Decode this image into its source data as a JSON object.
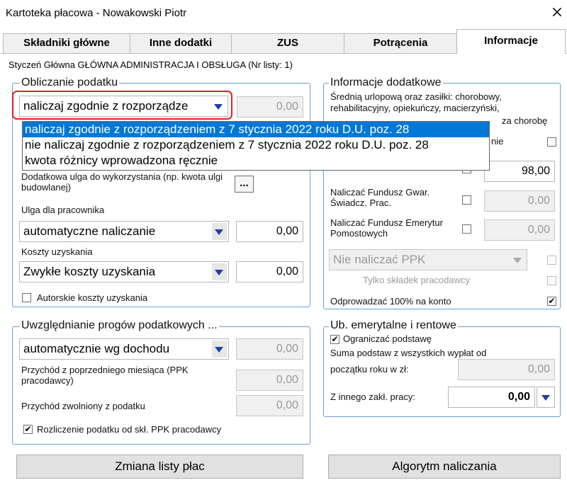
{
  "window": {
    "title": "Kartoteka płacowa - Nowakowski Piotr",
    "close_label": "×"
  },
  "tabs": [
    "Składniki główne",
    "Inne dodatki",
    "ZUS",
    "Potrącenia",
    "Informacje"
  ],
  "subtitle": "Styczeń Główna GŁÓWNA ADMINISTRACJA I OBSŁUGA  (Nr listy: 1)",
  "obliczanie": {
    "title": "Obliczanie podatku",
    "combo_value": "naliczaj zgodnie z rozporządze",
    "combo_amount": "0,00",
    "dropdown_options": [
      "naliczaj zgodnie z rozporządzeniem z 7 stycznia 2022 roku D.U. poz. 28",
      "nie naliczaj zgodnie z rozporządzeniem z 7 stycznia 2022 roku D.U. poz. 28",
      "kwota różnicy wprowadzona ręcznie"
    ],
    "dodatkowa_label": "Dodatkowa ulga do wykorzystania (np. kwota ulgi budowlanej)",
    "ellipsis": "...",
    "ulga_label": "Ulga dla pracownika",
    "ulga_value": "automatyczne naliczanie",
    "ulga_amount": "0,00",
    "koszty_label": "Koszty uzyskania",
    "koszty_value": "Zwykłe koszty uzyskania",
    "koszty_amount": "0,00",
    "autorskie_label": "Autorskie koszty uzyskania"
  },
  "progi": {
    "title": "Uwzględnianie progów podatkowych ...",
    "combo_value": "automatycznie wg dochodu",
    "combo_amount": "0,00",
    "przychod_label": "Przychód z poprzedniego miesiąca (PPK pracodawcy)",
    "przychod_amount": "0,00",
    "zwolniony_label": "Przychód zwolniony z podatku",
    "zwolniony_amount": "0,00",
    "rozliczenie_label": "Rozliczenie podatku od skł. PPK pracodawcy",
    "rozliczenie_checked": "✔"
  },
  "informacje": {
    "title": "Informacje dodatkowe",
    "srednia_label": "Średnią urlopową oraz zasiłki: chorobowy, rehabilitacyjny, opiekuńczy, macierzyński,",
    "za_chorobe": "za chorobę",
    "nie_fragment": "nie",
    "wartosc": "98,00",
    "fgsp_label": "Naliczać Fundusz Gwar. Świadcz. Prac.",
    "fgsp_amount": "0,00",
    "fep_label": "Naliczać Fundusz Emerytur Pomostowych",
    "fep_amount": "0,00",
    "ppk_value": "Nie naliczać PPK",
    "tylko_label": "Tylko składek pracodawcy",
    "odprowadzac_label": "Odprowadzać 100% na konto",
    "odprowadzac_checked": "✔"
  },
  "emerytalne": {
    "title": "Ub. emerytalne i rentowe",
    "ograniczac_label": "Ograniczać podstawę",
    "ograniczac_checked": "✔",
    "suma_label": "Suma podstaw z wszystkich wypłat od",
    "poczatek_label": "początku roku w zł:",
    "poczatek_amount": "0,00",
    "inny_label": "Z innego zakł. pracy:",
    "inny_amount": "0,00"
  },
  "buttons": {
    "zmiana": "Zmiana listy płac",
    "algorytm": "Algorytm naliczania"
  }
}
